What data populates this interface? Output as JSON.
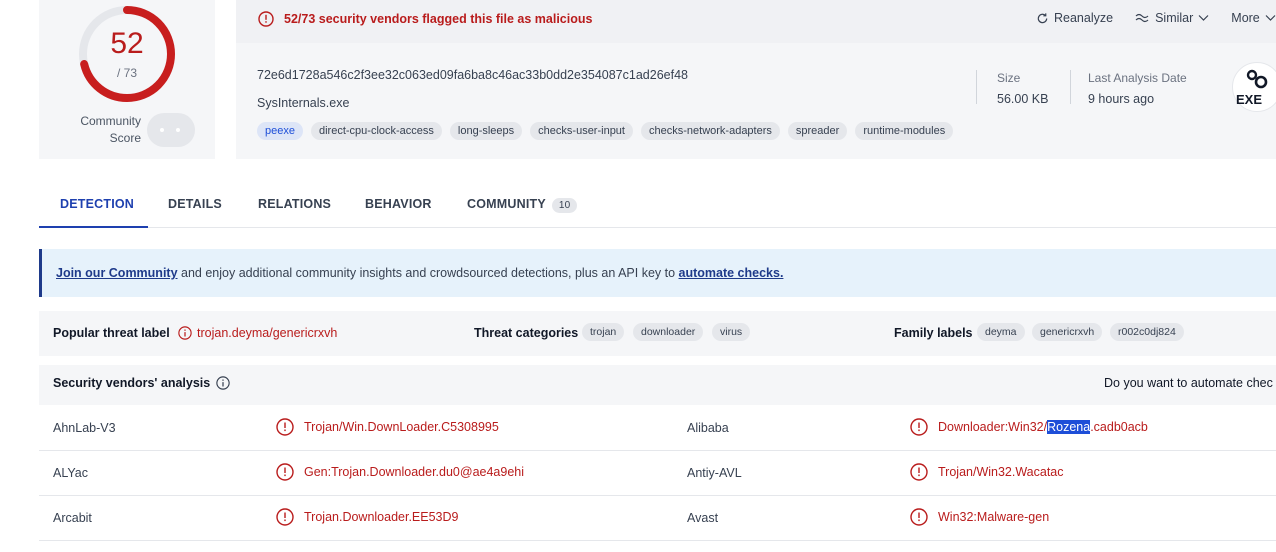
{
  "score": {
    "detections": "52",
    "total": "/ 73",
    "detection_fraction": 0.712,
    "community_label_1": "Community",
    "community_label_2": "Score"
  },
  "alert": {
    "text": "52/73 security vendors flagged this file as malicious"
  },
  "actions": {
    "reanalyze": "Reanalyze",
    "similar": "Similar",
    "more": "More"
  },
  "file": {
    "hash": "72e6d1728a546c2f3ee32c063ed09fa6ba8c46ac33b0dd2e354087c1ad26ef48",
    "name": "SysInternals.exe",
    "tags": [
      "peexe",
      "direct-cpu-clock-access",
      "long-sleeps",
      "checks-user-input",
      "checks-network-adapters",
      "spreader",
      "runtime-modules"
    ],
    "size_label": "Size",
    "size_value": "56.00 KB",
    "date_label": "Last Analysis Date",
    "date_value": "9 hours ago",
    "type_icon_text": "EXE"
  },
  "tabs": {
    "detection": "DETECTION",
    "details": "DETAILS",
    "relations": "RELATIONS",
    "behavior": "BEHAVIOR",
    "community": "COMMUNITY",
    "community_count": "10"
  },
  "banner": {
    "link1": "Join our Community",
    "middle": " and enjoy additional community insights and crowdsourced detections, plus an API key to ",
    "link2": "automate checks."
  },
  "threat": {
    "popular_label": "Popular threat label",
    "popular_value": "trojan.deyma/genericrxvh",
    "categories_label": "Threat categories",
    "categories": [
      "trojan",
      "downloader",
      "virus"
    ],
    "family_label": "Family labels",
    "families": [
      "deyma",
      "genericrxvh",
      "r002c0dj824"
    ]
  },
  "vendors": {
    "title": "Security vendors' analysis",
    "automate_prompt": "Do you want to automate chec",
    "rows": [
      {
        "left_name": "AhnLab-V3",
        "left_result": "Trojan/Win.DownLoader.C5308995",
        "right_name": "Alibaba",
        "right_pre": "Downloader:Win32/",
        "right_hl": "Rozena",
        "right_post": ".cadb0acb"
      },
      {
        "left_name": "ALYac",
        "left_result": "Gen:Trojan.Downloader.du0@ae4a9ehi",
        "right_name": "Antiy-AVL",
        "right_pre": "Trojan/Win32.Wacatac",
        "right_hl": "",
        "right_post": ""
      },
      {
        "left_name": "Arcabit",
        "left_result": "Trojan.Downloader.EE53D9",
        "right_name": "Avast",
        "right_pre": "Win32:Malware-gen",
        "right_hl": "",
        "right_post": ""
      }
    ]
  },
  "colors": {
    "malicious": "#b91c1c",
    "accent": "#1e40af"
  },
  "icons": {
    "alert": "alert-circle-icon",
    "reanalyze": "refresh-icon",
    "similar": "similar-icon",
    "info": "info-icon",
    "file_type": "exe-file-icon"
  }
}
